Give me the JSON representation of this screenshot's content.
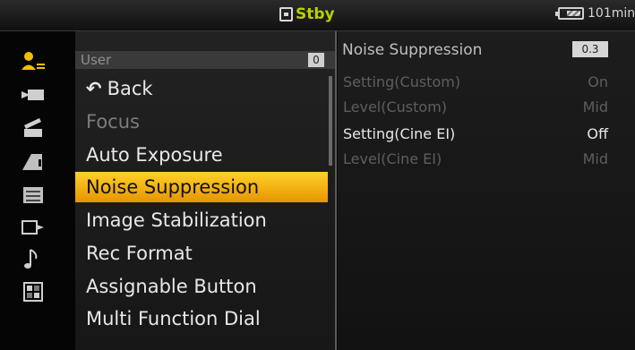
{
  "status": {
    "mode": "Stby",
    "remaining": "101min"
  },
  "menu": {
    "header": "User",
    "page": "0",
    "items": [
      {
        "label": "Back",
        "state": "back"
      },
      {
        "label": "Focus",
        "state": "disabled"
      },
      {
        "label": "Auto Exposure",
        "state": "normal"
      },
      {
        "label": "Noise Suppression",
        "state": "selected"
      },
      {
        "label": "Image Stabilization",
        "state": "normal"
      },
      {
        "label": "Rec Format",
        "state": "normal"
      },
      {
        "label": "Assignable Button",
        "state": "normal"
      },
      {
        "label": "Multi Function Dial",
        "state": "normal"
      }
    ]
  },
  "detail": {
    "title": "Noise Suppression",
    "page": "0.3",
    "rows": [
      {
        "label": "Setting(Custom)",
        "value": "On",
        "state": "disabled"
      },
      {
        "label": "Level(Custom)",
        "value": "Mid",
        "state": "disabled"
      },
      {
        "label": "Setting(Cine EI)",
        "value": "Off",
        "state": "enabled"
      },
      {
        "label": "Level(Cine EI)",
        "value": "Mid",
        "state": "disabled"
      }
    ]
  },
  "icons": [
    "user-menu-icon",
    "camera-icon",
    "clapper-icon",
    "paint-icon",
    "tc-icon",
    "output-icon",
    "audio-icon",
    "grid-icon"
  ],
  "colors": {
    "selection": "#f5b400",
    "standby": "#b8d200"
  }
}
